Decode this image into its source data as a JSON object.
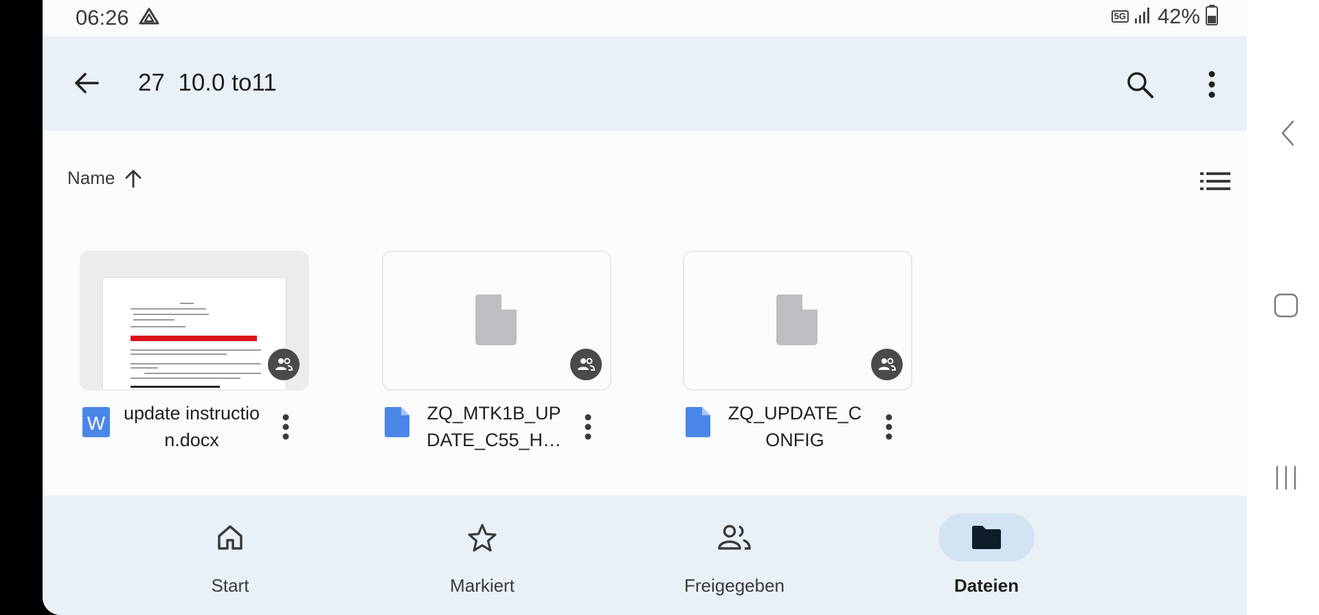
{
  "status": {
    "time": "06:26",
    "network": "5G",
    "battery": "42%"
  },
  "header": {
    "title": "27  10.0 to11"
  },
  "sort": {
    "label": "Name"
  },
  "files": [
    {
      "name": "update instruction.docx",
      "type": "word"
    },
    {
      "name": "ZQ_MTK1B_UPDATE_C55_H…",
      "type": "file"
    },
    {
      "name": "ZQ_UPDATE_CONFIG",
      "type": "file"
    }
  ],
  "bottom_nav": [
    {
      "label": "Start",
      "icon": "home-icon"
    },
    {
      "label": "Markiert",
      "icon": "star-icon"
    },
    {
      "label": "Freigegeben",
      "icon": "shared-icon"
    },
    {
      "label": "Dateien",
      "icon": "folder-icon",
      "active": true
    }
  ],
  "colors": {
    "accent": "#4a86e8",
    "active_pill": "#d3e3f4",
    "toolbar": "#e9f0f6"
  }
}
